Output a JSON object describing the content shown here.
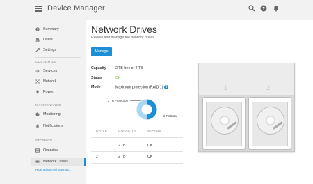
{
  "app": {
    "title": "Device Manager"
  },
  "topbar": {
    "icons": [
      "search-icon",
      "help-icon",
      "bell-icon"
    ]
  },
  "sidebar": {
    "items_main": [
      {
        "label": "Summary",
        "icon": "info-circle-icon"
      },
      {
        "label": "Users",
        "icon": "users-icon"
      },
      {
        "label": "Settings",
        "icon": "wrench-icon"
      }
    ],
    "section_customize": "CUSTOMIZE",
    "items_customize": [
      {
        "label": "Services",
        "icon": "gear-icon"
      },
      {
        "label": "Network",
        "icon": "network-icon"
      },
      {
        "label": "Power",
        "icon": "lightbulb-icon"
      }
    ],
    "section_maintenance": "MAINTENANCE",
    "items_maintenance": [
      {
        "label": "Monitoring",
        "icon": "monitoring-icon"
      },
      {
        "label": "Notifications",
        "icon": "bell-icon"
      }
    ],
    "section_storage": "STORAGE",
    "items_storage": [
      {
        "label": "Overview",
        "icon": "overview-icon"
      },
      {
        "label": "Network Drives",
        "icon": "drive-icon",
        "active": true
      }
    ],
    "advanced_link": "Hide advanced settings..."
  },
  "main": {
    "title": "Network Drives",
    "subtitle": "Review and manage the network drives.",
    "manage_button": "Manage",
    "properties": {
      "capacity_label": "Capacity",
      "capacity_value": "2 TB free of 2 TB",
      "status_label": "Status",
      "status_value": "OK",
      "mode_label": "Mode",
      "mode_value": "Maximum protection (RAID 1)"
    },
    "donut": {
      "protection_label": "2 TB Protection",
      "data_label": "2 TB Data",
      "colors": {
        "ring": "#1d8fd8",
        "light": "#a9d6f2",
        "track": "#e5e5e5"
      }
    },
    "table": {
      "headers": [
        "DRIVE",
        "CAPACITY",
        "STATUS"
      ],
      "rows": [
        {
          "drive": "1",
          "capacity": "2 TB",
          "status": "OK"
        },
        {
          "drive": "2",
          "capacity": "2 TB",
          "status": "OK"
        }
      ]
    },
    "device": {
      "bays": [
        "1",
        "2"
      ]
    }
  },
  "colors": {
    "accent": "#1d8fd8",
    "ok": "#6cbf3a"
  }
}
